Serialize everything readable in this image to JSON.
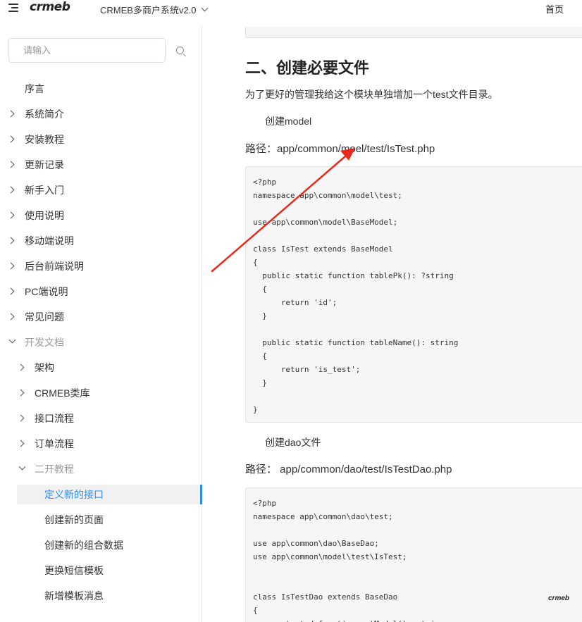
{
  "header": {
    "logo": "crmeb",
    "product_name": "CRMEB多商户系统v2.0",
    "home_link": "首页"
  },
  "sidebar": {
    "search_placeholder": "请输入",
    "items": [
      {
        "label": "序言"
      },
      {
        "label": "系统简介"
      },
      {
        "label": "安装教程"
      },
      {
        "label": "更新记录"
      },
      {
        "label": "新手入门"
      },
      {
        "label": "使用说明"
      },
      {
        "label": "移动端说明"
      },
      {
        "label": "后台前端说明"
      },
      {
        "label": "PC端说明"
      },
      {
        "label": "常见问题"
      },
      {
        "label": "开发文档"
      },
      {
        "label": "架构"
      },
      {
        "label": "CRMEB类库"
      },
      {
        "label": "接口流程"
      },
      {
        "label": "订单流程"
      },
      {
        "label": "二开教程"
      },
      {
        "label": "定义新的接口"
      },
      {
        "label": "创建新的页面"
      },
      {
        "label": "创建新的组合数据"
      },
      {
        "label": "更换短信模板"
      },
      {
        "label": "新增模板消息"
      }
    ]
  },
  "content": {
    "section_title": "二、创建必要文件",
    "intro": "为了更好的管理我给这个模块单独增加一个test文件目录。",
    "model_heading": "创建model",
    "model_path": "路径：app/common/moel/test/IsTest.php",
    "model_code": "<?php\nnamespace app\\common\\model\\test;\n\nuse app\\common\\model\\BaseModel;\n\nclass IsTest extends BaseModel\n{\n  public static function tablePk(): ?string\n  {\n      return 'id';\n  }\n\n  public static function tableName(): string\n  {\n      return 'is_test';\n  }\n\n}",
    "dao_heading": "创建dao文件",
    "dao_path": "路径： app/common/dao/test/IsTestDao.php",
    "dao_code": "<?php\nnamespace app\\common\\dao\\test;\n\nuse app\\common\\dao\\BaseDao;\nuse app\\common\\model\\test\\IsTest;\n\n\nclass IsTestDao extends BaseDao\n{\n    protected function getModel(): string",
    "watermark": "crmeb"
  },
  "colors": {
    "accent": "#2d8cf0",
    "annotation_arrow": "#e8291c"
  }
}
